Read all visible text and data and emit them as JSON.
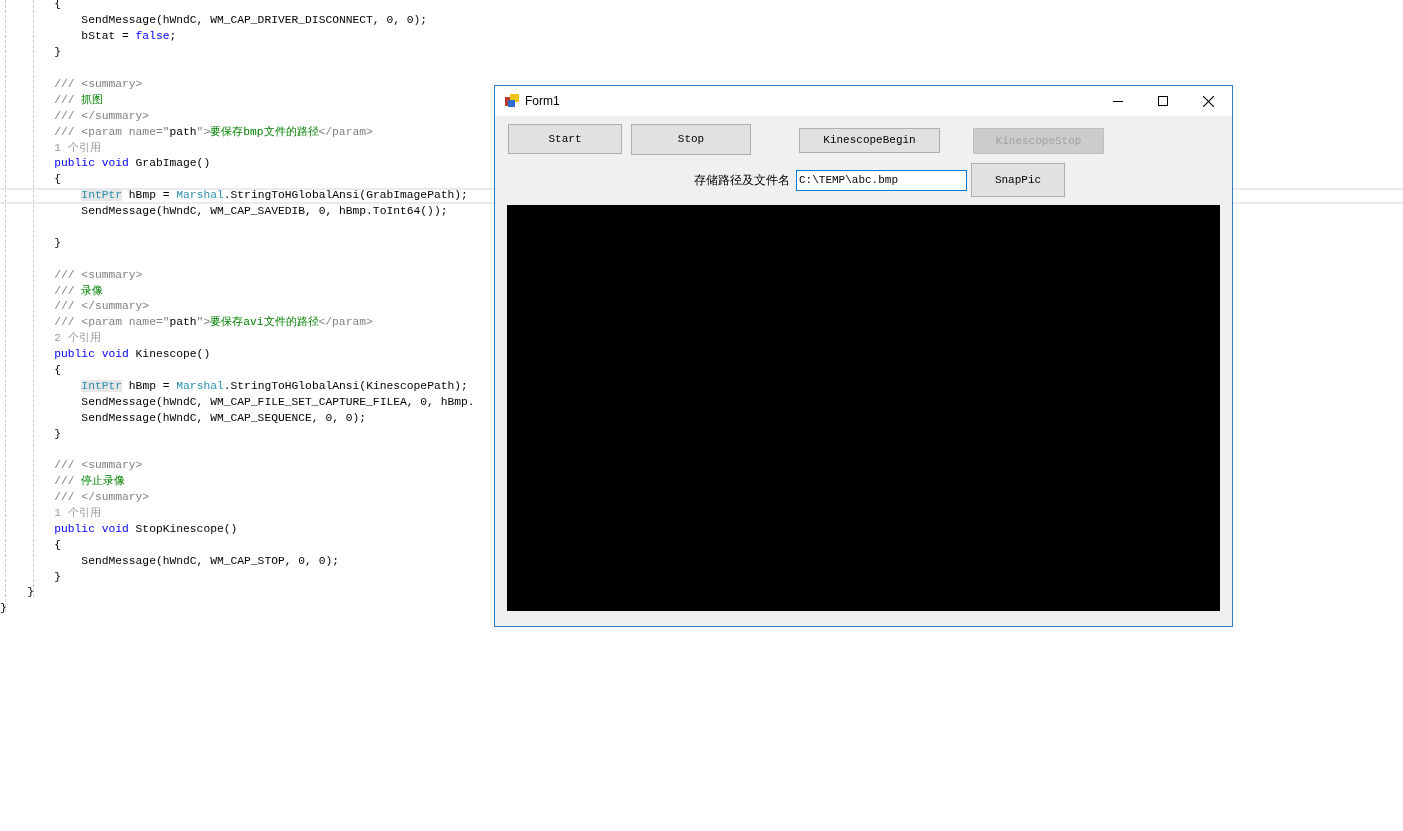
{
  "code_editor": {
    "lines": [
      {
        "kind": "code",
        "current": false,
        "segments": [
          {
            "kind": "text",
            "text": "        {"
          }
        ]
      },
      {
        "kind": "code",
        "current": false,
        "segments": [
          {
            "kind": "text",
            "text": "            SendMessage(hWndC, WM_CAP_DRIVER_DISCONNECT, 0, 0);"
          }
        ]
      },
      {
        "kind": "code",
        "current": false,
        "segments": [
          {
            "kind": "text",
            "text": "            bStat = "
          },
          {
            "kind": "keyword",
            "text": "false"
          },
          {
            "kind": "text",
            "text": ";"
          }
        ]
      },
      {
        "kind": "code",
        "current": false,
        "segments": [
          {
            "kind": "text",
            "text": "        }"
          }
        ]
      },
      {
        "kind": "blank"
      },
      {
        "kind": "code",
        "current": false,
        "segments": [
          {
            "kind": "doc",
            "text": "        /// <summary>"
          }
        ]
      },
      {
        "kind": "code",
        "current": false,
        "segments": [
          {
            "kind": "doc",
            "text": "        /// "
          },
          {
            "kind": "comment",
            "text": "抓图"
          }
        ]
      },
      {
        "kind": "code",
        "current": false,
        "segments": [
          {
            "kind": "doc",
            "text": "        /// </summary>"
          }
        ]
      },
      {
        "kind": "code",
        "current": false,
        "segments": [
          {
            "kind": "doc",
            "text": "        /// <param name=\""
          },
          {
            "kind": "text",
            "text": "path"
          },
          {
            "kind": "doc",
            "text": "\">"
          },
          {
            "kind": "comment",
            "text": "要保存bmp文件的路径"
          },
          {
            "kind": "doc",
            "text": "</param>"
          }
        ]
      },
      {
        "kind": "code",
        "current": false,
        "segments": [
          {
            "kind": "lens",
            "text": "        1 个引用"
          }
        ]
      },
      {
        "kind": "code",
        "current": false,
        "segments": [
          {
            "kind": "keyword",
            "text": "        public void"
          },
          {
            "kind": "text",
            "text": " GrabImage()"
          }
        ]
      },
      {
        "kind": "code",
        "current": false,
        "segments": [
          {
            "kind": "text",
            "text": "        {"
          }
        ]
      },
      {
        "kind": "code",
        "current": true,
        "segments": [
          {
            "kind": "type_marked",
            "text": "            IntPtr"
          },
          {
            "kind": "text",
            "text": " hBmp = "
          },
          {
            "kind": "type",
            "text": "Marshal"
          },
          {
            "kind": "text",
            "text": ".StringToHGlobalAnsi(GrabImagePath);"
          }
        ]
      },
      {
        "kind": "code",
        "current": false,
        "segments": [
          {
            "kind": "text",
            "text": "            SendMessage(hWndC, WM_CAP_SAVEDIB, 0, hBmp.ToInt64());"
          }
        ]
      },
      {
        "kind": "blank"
      },
      {
        "kind": "code",
        "current": false,
        "segments": [
          {
            "kind": "text",
            "text": "        }"
          }
        ]
      },
      {
        "kind": "blank"
      },
      {
        "kind": "code",
        "current": false,
        "segments": [
          {
            "kind": "doc",
            "text": "        /// <summary>"
          }
        ]
      },
      {
        "kind": "code",
        "current": false,
        "segments": [
          {
            "kind": "doc",
            "text": "        /// "
          },
          {
            "kind": "comment",
            "text": "录像"
          }
        ]
      },
      {
        "kind": "code",
        "current": false,
        "segments": [
          {
            "kind": "doc",
            "text": "        /// </summary>"
          }
        ]
      },
      {
        "kind": "code",
        "current": false,
        "segments": [
          {
            "kind": "doc",
            "text": "        /// <param name=\""
          },
          {
            "kind": "text",
            "text": "path"
          },
          {
            "kind": "doc",
            "text": "\">"
          },
          {
            "kind": "comment",
            "text": "要保存avi文件的路径"
          },
          {
            "kind": "doc",
            "text": "</param>"
          }
        ]
      },
      {
        "kind": "code",
        "current": false,
        "segments": [
          {
            "kind": "lens",
            "text": "        2 个引用"
          }
        ]
      },
      {
        "kind": "code",
        "current": false,
        "segments": [
          {
            "kind": "keyword",
            "text": "        public void"
          },
          {
            "kind": "text",
            "text": " Kinescope()"
          }
        ]
      },
      {
        "kind": "code",
        "current": false,
        "segments": [
          {
            "kind": "text",
            "text": "        {"
          }
        ]
      },
      {
        "kind": "code",
        "current": false,
        "segments": [
          {
            "kind": "type_marked",
            "text": "            IntPtr"
          },
          {
            "kind": "text",
            "text": " hBmp = "
          },
          {
            "kind": "type",
            "text": "Marshal"
          },
          {
            "kind": "text",
            "text": ".StringToHGlobalAnsi(KinescopePath);"
          }
        ]
      },
      {
        "kind": "code",
        "current": false,
        "segments": [
          {
            "kind": "text",
            "text": "            SendMessage(hWndC, WM_CAP_FILE_SET_CAPTURE_FILEA, 0, hBmp."
          }
        ]
      },
      {
        "kind": "code",
        "current": false,
        "segments": [
          {
            "kind": "text",
            "text": "            SendMessage(hWndC, WM_CAP_SEQUENCE, 0, 0);"
          }
        ]
      },
      {
        "kind": "code",
        "current": false,
        "segments": [
          {
            "kind": "text",
            "text": "        }"
          }
        ]
      },
      {
        "kind": "blank"
      },
      {
        "kind": "code",
        "current": false,
        "segments": [
          {
            "kind": "doc",
            "text": "        /// <summary>"
          }
        ]
      },
      {
        "kind": "code",
        "current": false,
        "segments": [
          {
            "kind": "doc",
            "text": "        /// "
          },
          {
            "kind": "comment",
            "text": "停止录像"
          }
        ]
      },
      {
        "kind": "code",
        "current": false,
        "segments": [
          {
            "kind": "doc",
            "text": "        /// </summary>"
          }
        ]
      },
      {
        "kind": "code",
        "current": false,
        "segments": [
          {
            "kind": "lens",
            "text": "        1 个引用"
          }
        ]
      },
      {
        "kind": "code",
        "current": false,
        "segments": [
          {
            "kind": "keyword",
            "text": "        public void"
          },
          {
            "kind": "text",
            "text": " StopKinescope()"
          }
        ]
      },
      {
        "kind": "code",
        "current": false,
        "segments": [
          {
            "kind": "text",
            "text": "        {"
          }
        ]
      },
      {
        "kind": "code",
        "current": false,
        "segments": [
          {
            "kind": "text",
            "text": "            SendMessage(hWndC, WM_CAP_STOP, 0, 0);"
          }
        ]
      },
      {
        "kind": "code",
        "current": false,
        "segments": [
          {
            "kind": "text",
            "text": "        }"
          }
        ]
      },
      {
        "kind": "code",
        "current": false,
        "segments": [
          {
            "kind": "text",
            "text": "    }"
          }
        ]
      },
      {
        "kind": "code",
        "current": false,
        "segments": [
          {
            "kind": "text",
            "text": "}"
          }
        ]
      }
    ]
  },
  "window": {
    "title": "Form1",
    "buttons": [
      {
        "label": "Start",
        "disabled": false
      },
      {
        "label": "Stop",
        "disabled": false
      },
      {
        "label": "KinescopeBegin",
        "disabled": false
      },
      {
        "label": "KinescopeStop",
        "disabled": true
      }
    ],
    "path_label": "存储路径及文件名",
    "path_field": {
      "value": "C:\\TEMP\\abc.bmp"
    },
    "snap_button": {
      "label": "SnapPic",
      "disabled": false
    }
  }
}
